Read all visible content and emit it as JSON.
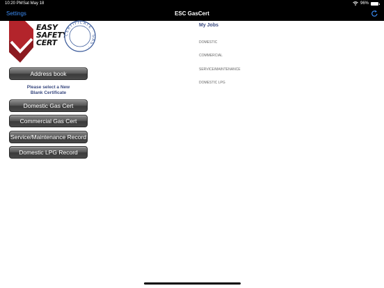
{
  "status_bar": {
    "time": "10:20 PM",
    "date": "Sat May 18",
    "battery": "96%"
  },
  "nav": {
    "settings_label": "Settings",
    "title": "ESC GasCert",
    "refresh_icon": "refresh-icon"
  },
  "logo": {
    "line1": "EASY",
    "line2": "SAFETY",
    "line3": "CERT",
    "seal_text": "CERTIFICATE · GAS ·"
  },
  "sidebar": {
    "address_book_label": "Address book",
    "prompt_line1": "Please select a New",
    "prompt_line2": "Blank Certificate",
    "buttons": [
      {
        "label": "Domestic Gas Cert"
      },
      {
        "label": "Commercial Gas Cert"
      },
      {
        "label": "Service/Maintenance Record"
      },
      {
        "label": "Domestic LPG Record"
      }
    ]
  },
  "jobs": {
    "title": "My Jobs",
    "items": [
      {
        "label": "DOMESTIC"
      },
      {
        "label": "COMMERCIAL"
      },
      {
        "label": "SERVICE/MAINTENANCE"
      },
      {
        "label": "DOMESTIC LPG"
      }
    ]
  },
  "colors": {
    "accent": "#3b8cf5",
    "heading": "#3a4a80",
    "button_dark": "#4a4a4a",
    "logo_red": "#b3242b"
  }
}
